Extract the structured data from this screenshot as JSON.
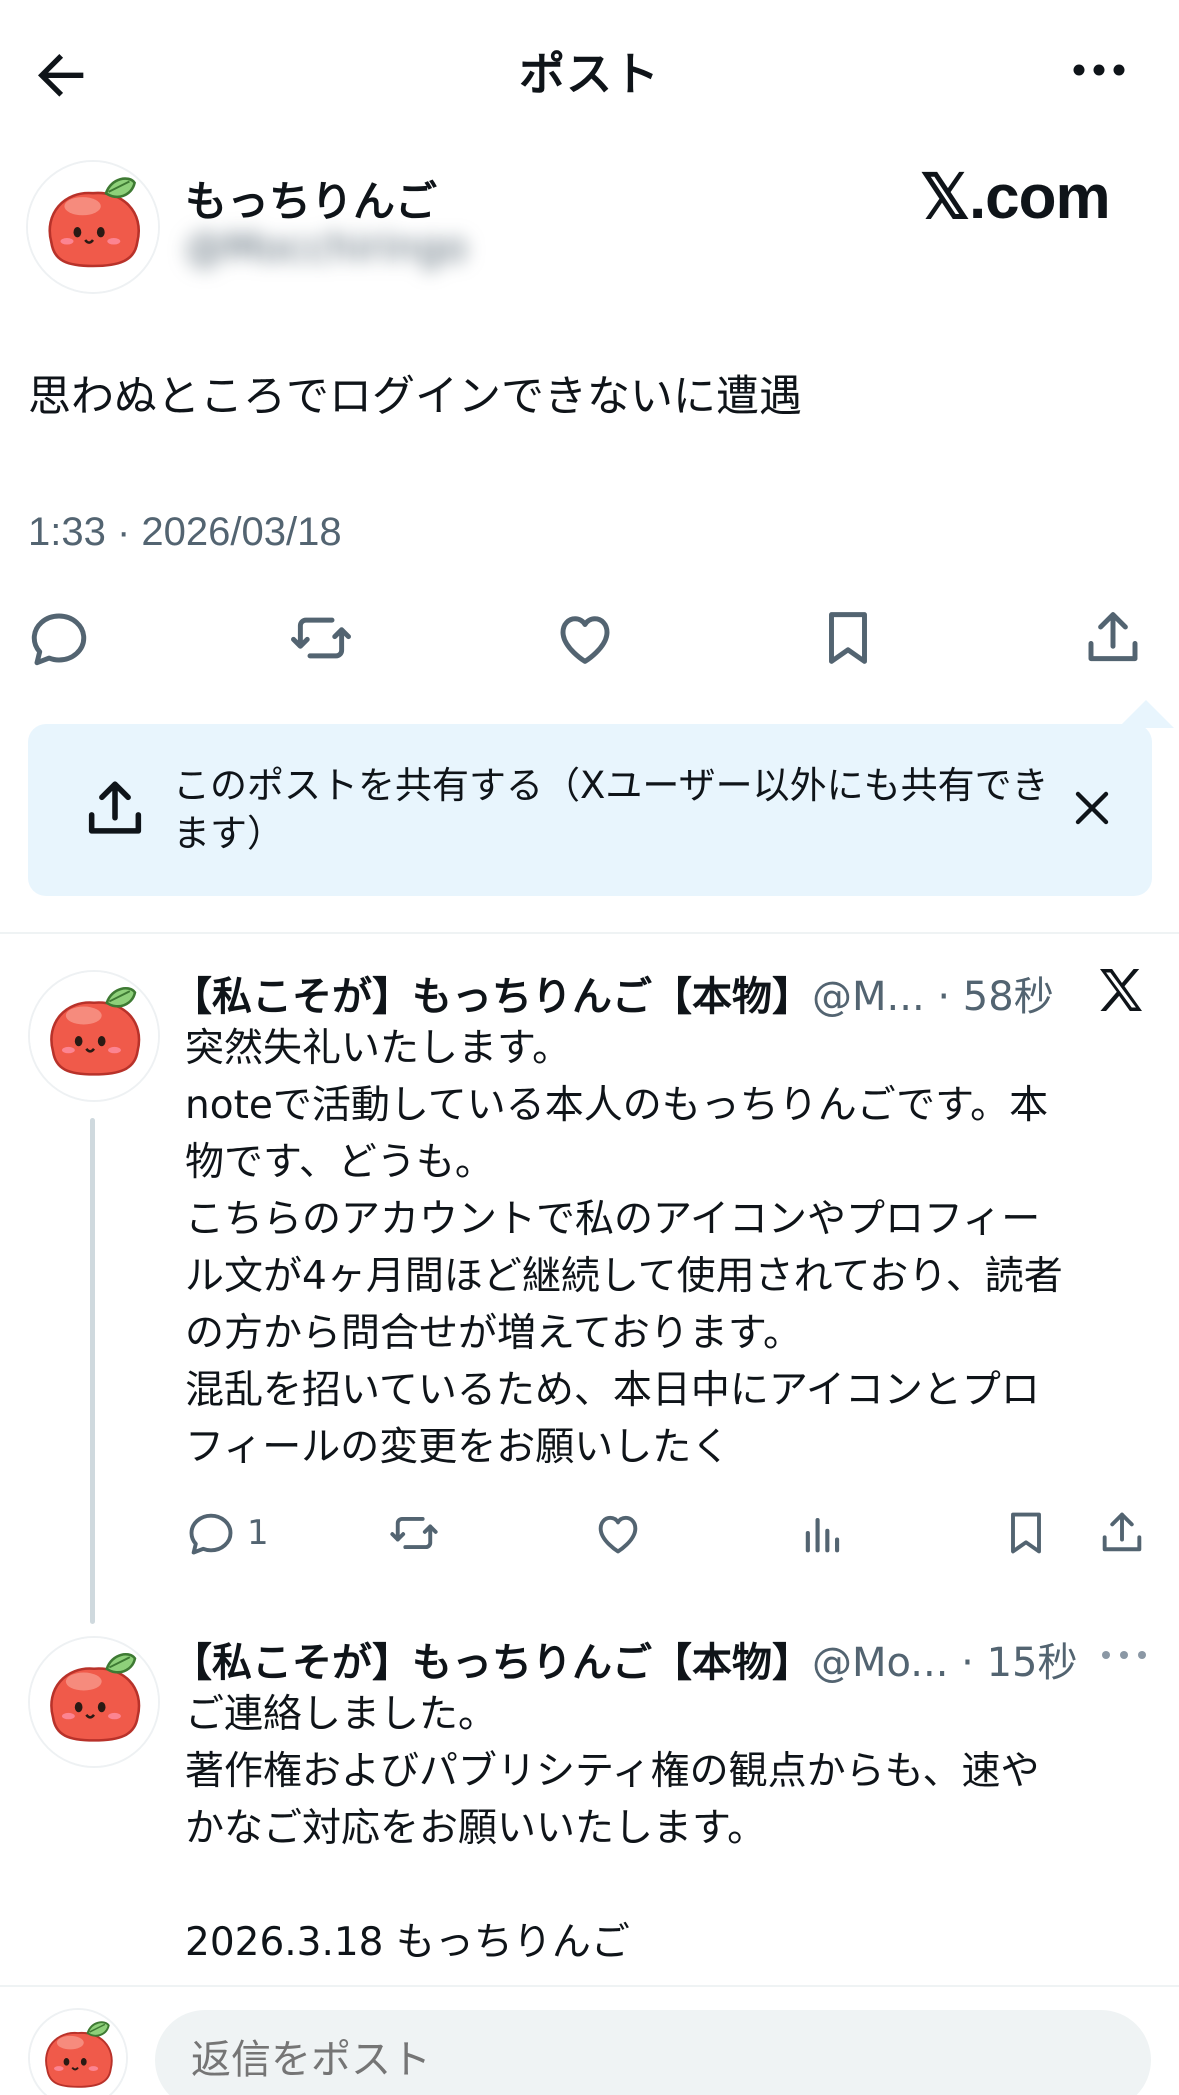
{
  "header": {
    "title": "ポスト"
  },
  "main_post": {
    "author_name": "もっちりんご",
    "author_handle": "@Mocchiringo",
    "watermark": "𝕏.com",
    "text": "思わぬところでログインできないに遭遇",
    "timestamp": "1:33 · 2026/03/18"
  },
  "share_banner": {
    "text": "このポストを共有する（Xユーザー以外にも共有できます）"
  },
  "replies": [
    {
      "name": "【私こそが】もっちりんご【本物】",
      "handle_meta": "@M... · 58秒",
      "lines": [
        "突然失礼いたします。",
        "noteで活動している本人のもっちりんごです。本",
        "物です、どうも。",
        "こちらのアカウントで私のアイコンやプロフィー",
        "ル文が4ヶ月間ほど継続して使用されており、読者",
        "の方から問合せが増えております。",
        "混乱を招いているため、本日中にアイコンとプロ",
        "フィールの変更をお願いしたく"
      ],
      "reply_count": "1"
    },
    {
      "name": "【私こそが】もっちりんご【本物】",
      "handle_meta": "@Mo... · 15秒",
      "lines": [
        "ご連絡しました。",
        "著作権およびパブリシティ権の観点からも、速や",
        "かなご対応をお願いいたします。",
        "",
        "2026.3.18 もっちりんご"
      ]
    }
  ],
  "reply_bar": {
    "placeholder": "返信をポスト"
  },
  "colors": {
    "text": "#0f1419",
    "secondary": "#536471",
    "banner_bg": "#e8f5fd",
    "divider": "#eff3f4",
    "avatar_apple": "#f05a4a"
  },
  "icons": [
    "back-arrow-icon",
    "more-icon",
    "reply-icon",
    "repost-icon",
    "like-icon",
    "bookmark-icon",
    "share-icon",
    "close-icon",
    "x-logo-icon",
    "views-icon"
  ]
}
